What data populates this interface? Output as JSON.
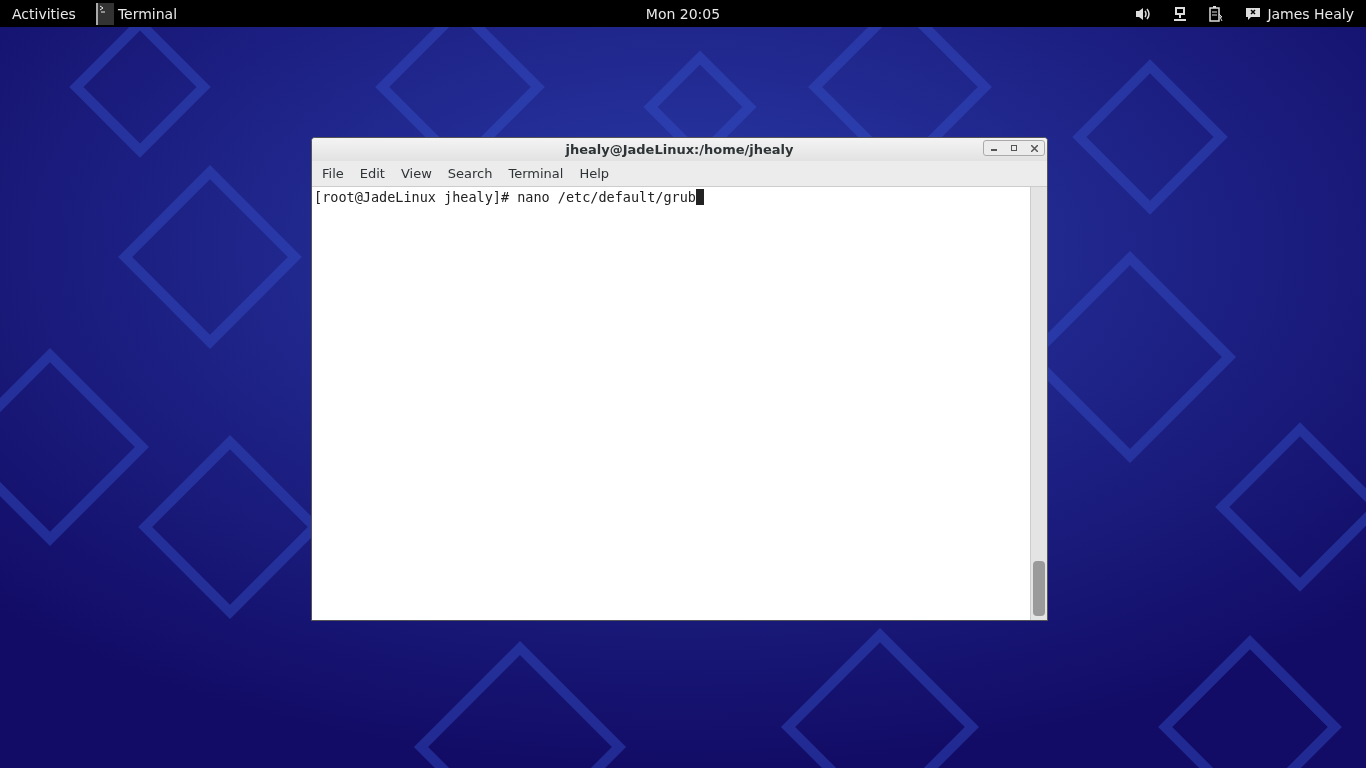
{
  "top_bar": {
    "activities": "Activities",
    "app_name": "Terminal",
    "clock": "Mon 20:05",
    "user_name": "James Healy"
  },
  "window": {
    "title": "jhealy@JadeLinux:/home/jhealy",
    "menu": [
      "File",
      "Edit",
      "View",
      "Search",
      "Terminal",
      "Help"
    ],
    "lines": [
      "[root@JadeLinux jhealy]# nano /etc/default/grub"
    ]
  }
}
